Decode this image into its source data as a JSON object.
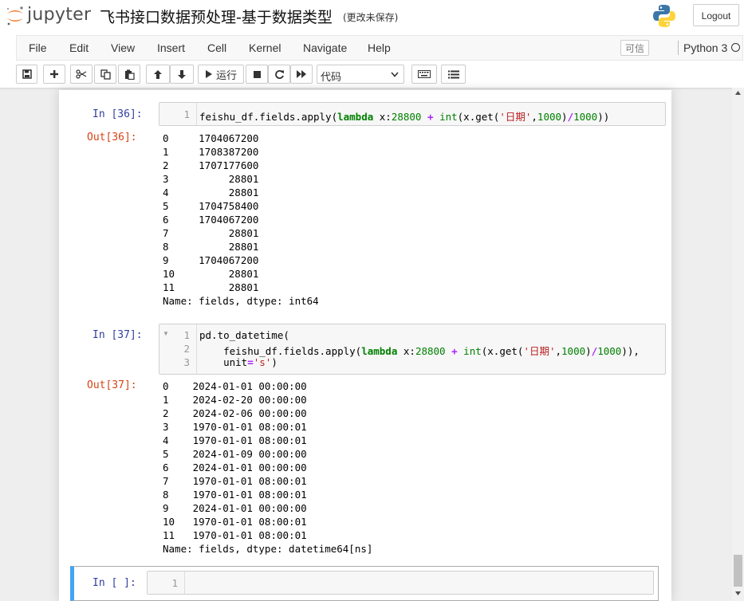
{
  "header": {
    "app_name": "jupyter",
    "notebook_title": "飞书接口数据预处理-基于数据类型",
    "save_status": "(更改未保存)",
    "logout_label": "Logout",
    "logo_color": "#f37626"
  },
  "menubar": {
    "items": [
      "File",
      "Edit",
      "View",
      "Insert",
      "Cell",
      "Kernel",
      "Navigate",
      "Help"
    ],
    "trusted_label": "可信",
    "kernel_name": "Python 3"
  },
  "toolbar": {
    "run_label": "运行",
    "cell_type": "代码",
    "icons": [
      "save-icon",
      "plus-icon",
      "cut-icon",
      "copy-icon",
      "paste-icon",
      "arrow-up-icon",
      "arrow-down-icon",
      "run-icon",
      "stop-icon",
      "restart-icon",
      "fast-forward-icon",
      "keyboard-icon",
      "list-icon"
    ]
  },
  "cells": [
    {
      "in_prompt": "In  [36]:",
      "line_numbers": [
        "1"
      ],
      "code": [
        "feishu_df.fields.apply(lambda x:28800 + int(x.get('日期',1000)/1000))"
      ],
      "out_prompt": "Out[36]:",
      "output": [
        "0     1704067200",
        "1     1708387200",
        "2     1707177600",
        "3          28801",
        "4          28801",
        "5     1704758400",
        "6     1704067200",
        "7          28801",
        "8          28801",
        "9     1704067200",
        "10         28801",
        "11         28801",
        "Name: fields, dtype: int64"
      ]
    },
    {
      "in_prompt": "In  [37]:",
      "line_numbers": [
        "1",
        "2",
        "3"
      ],
      "code": [
        "pd.to_datetime(",
        "    feishu_df.fields.apply(lambda x:28800 + int(x.get('日期',1000)/1000)),",
        "    unit='s')"
      ],
      "out_prompt": "Out[37]:",
      "output": [
        "0    2024-01-01 00:00:00",
        "1    2024-02-20 00:00:00",
        "2    2024-02-06 00:00:00",
        "3    1970-01-01 08:00:01",
        "4    1970-01-01 08:00:01",
        "5    2024-01-09 00:00:00",
        "6    2024-01-01 00:00:00",
        "7    1970-01-01 08:00:01",
        "8    1970-01-01 08:00:01",
        "9    2024-01-01 00:00:00",
        "10   1970-01-01 08:00:01",
        "11   1970-01-01 08:00:01",
        "Name: fields, dtype: datetime64[ns]"
      ]
    },
    {
      "in_prompt": "In  [ ]:",
      "line_numbers": [
        "1"
      ],
      "code": [
        ""
      ]
    }
  ],
  "colors": {
    "in_prompt": "#303f9f",
    "out_prompt": "#d84315",
    "selected_cell_border": "#42a5f5",
    "keyword": "#008000",
    "operator": "#aa22ff",
    "string": "#ba2121"
  }
}
